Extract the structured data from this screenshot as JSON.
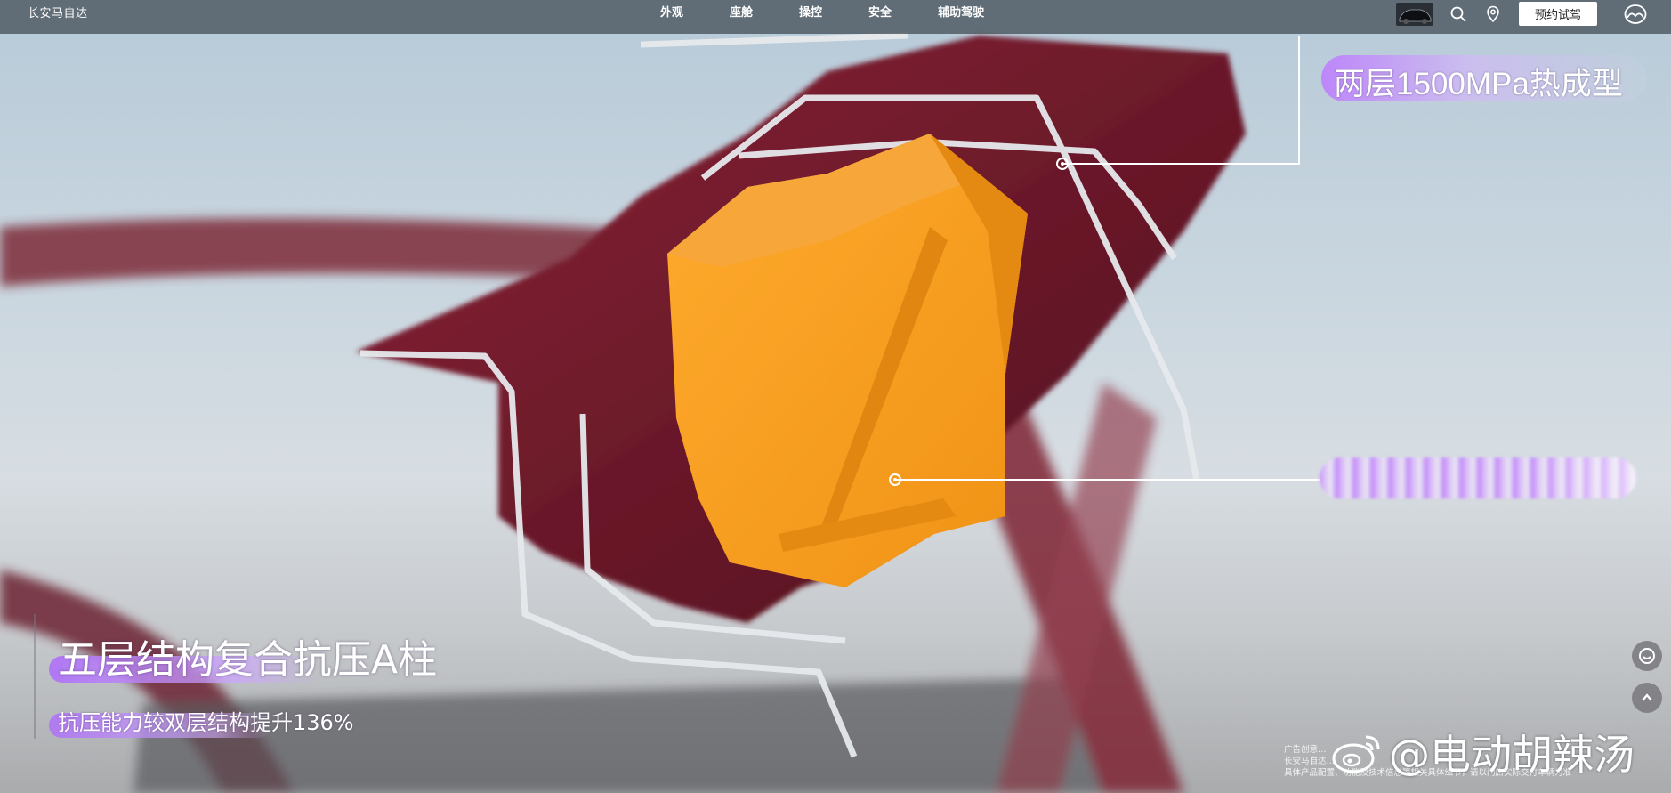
{
  "nav": {
    "brand": "长安马自达",
    "menu": [
      "外观",
      "座舱",
      "操控",
      "安全",
      "辅助驾驶"
    ],
    "test_drive_label": "预约试驾",
    "icons": [
      "car-thumbnail",
      "search-icon",
      "location-pin-icon",
      "mazda-logo-icon"
    ]
  },
  "hero": {
    "callout_top": "两层1500MPa热成型",
    "headline": "五层结构复合抗压A柱",
    "subline": "抗压能力较双层结构提升136%"
  },
  "floating_buttons": [
    "customer-service-icon",
    "back-to-top-icon"
  ],
  "disclaimer": [
    "广告创意…",
    "长安马自达…",
    "具体产品配置、功能及技术信息等相关具体细节，请以门店实际交付车辆为准"
  ],
  "watermark": {
    "text": "@电动胡辣汤",
    "logo": "weibo-logo"
  },
  "colors": {
    "nav_bg": "#48525A",
    "callout_purple": "#BD7AFF",
    "pillar_red": "#7A1E30",
    "block_orange": "#F39A1C"
  }
}
